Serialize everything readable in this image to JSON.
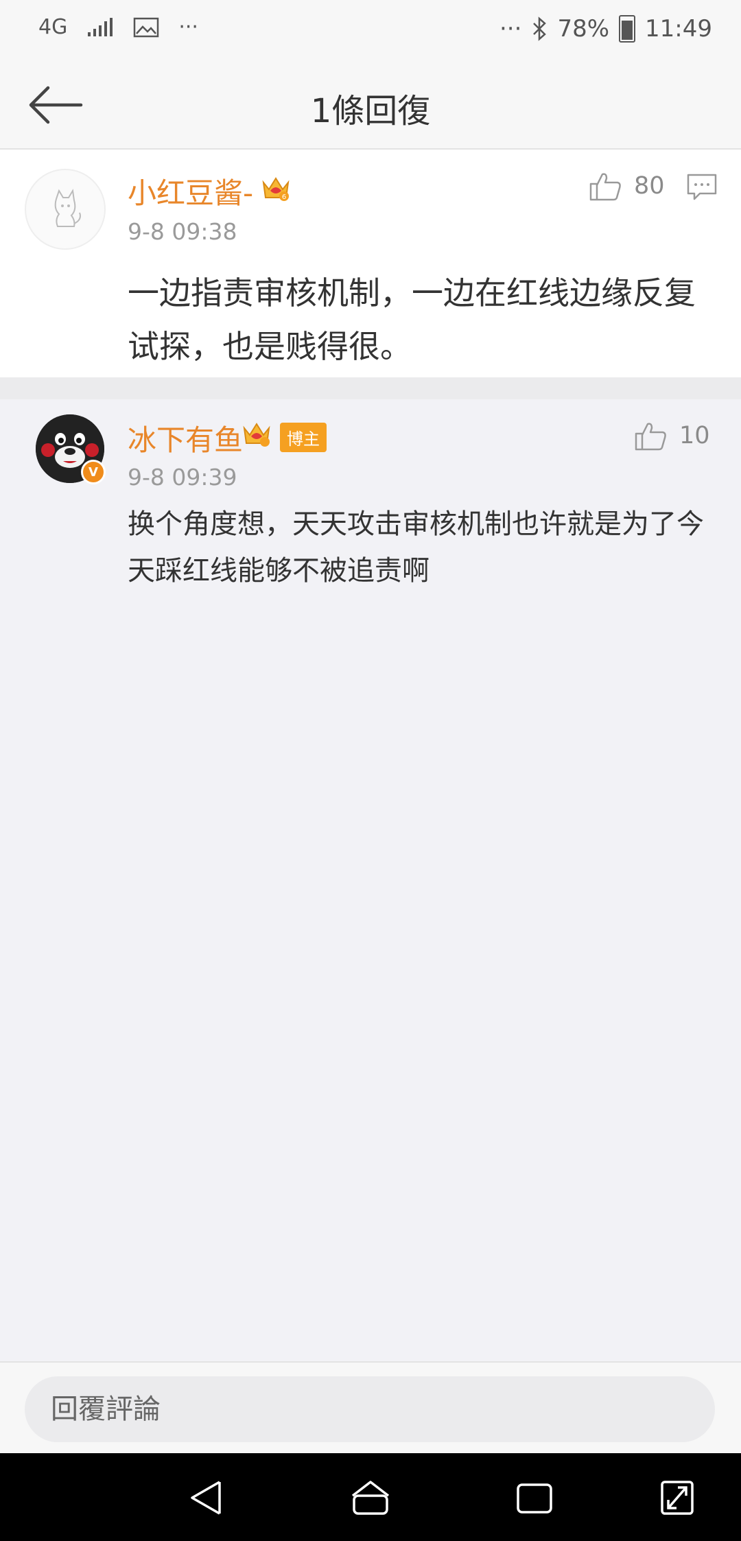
{
  "status_bar": {
    "network": "4G",
    "dots_left": "···",
    "dots_right": "···",
    "battery": "78%",
    "time": "11:49"
  },
  "header": {
    "title": "1條回復"
  },
  "main_comment": {
    "username": "小红豆酱-",
    "level_badge": "6",
    "time": "9-8 09:38",
    "likes": "80",
    "text": "一边指责审核机制，一边在红线边缘反复试探，也是贱得很。"
  },
  "reply": {
    "username": "冰下有鱼",
    "badge": "博主",
    "verified": "V",
    "time": "9-8 09:39",
    "likes": "10",
    "text": "换个角度想，天天攻击审核机制也许就是为了今天踩红线能够不被追责啊"
  },
  "bottom": {
    "reply_placeholder": "回覆評論"
  },
  "colors": {
    "username": "#e8862a",
    "badge": "#f5a021",
    "background": "#f2f2f6"
  }
}
